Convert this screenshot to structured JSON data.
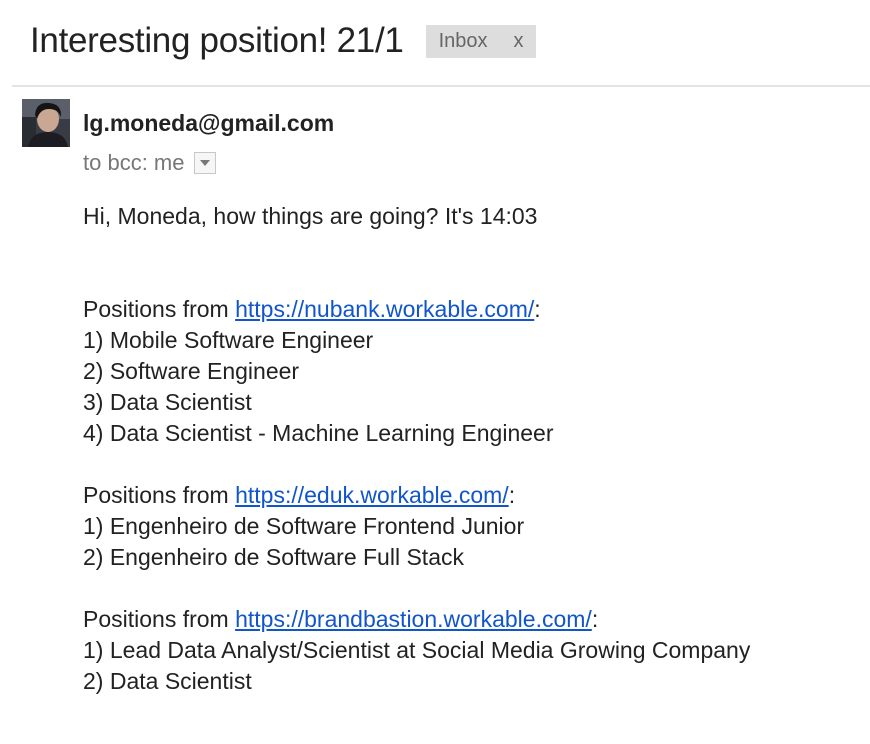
{
  "subject": "Interesting position! 21/1",
  "label": {
    "text": "Inbox",
    "close": "x"
  },
  "sender": "lg.moneda@gmail.com",
  "recipients": "to bcc: me",
  "greeting": "Hi, Moneda, how things are going? It's 14:03",
  "sections": [
    {
      "prefix": "Positions from ",
      "url": "https://nubank.workable.com/",
      "suffix": ":",
      "positions": [
        "1) Mobile Software Engineer",
        "2) Software Engineer",
        "3) Data Scientist",
        "4) Data Scientist - Machine Learning Engineer"
      ]
    },
    {
      "prefix": "Positions from ",
      "url": "https://eduk.workable.com/",
      "suffix": ":",
      "positions": [
        "1) Engenheiro de Software Frontend Junior",
        "2) Engenheiro de Software Full Stack"
      ]
    },
    {
      "prefix": "Positions from ",
      "url": "https://brandbastion.workable.com/",
      "suffix": ":",
      "positions": [
        "1) Lead Data Analyst/Scientist at Social Media Growing Company",
        "2) Data Scientist"
      ]
    }
  ]
}
